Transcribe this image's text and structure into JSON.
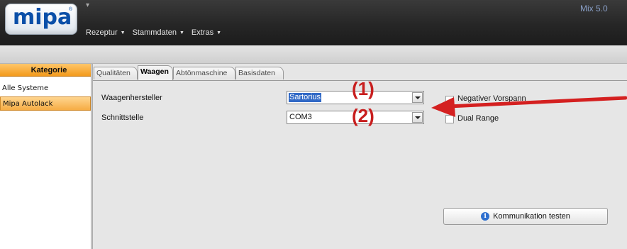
{
  "app": {
    "logo_text": "mipa",
    "logo_mark": "®",
    "title": "Mix 5.0",
    "quick_access_glyph": "▾"
  },
  "menu": [
    {
      "label": "Rezeptur"
    },
    {
      "label": "Stammdaten"
    },
    {
      "label": "Extras"
    }
  ],
  "left_panel": {
    "header": "Kategorie",
    "items": [
      {
        "label": "Alle Systeme",
        "selected": false
      },
      {
        "label": "Mipa Autolack",
        "selected": true
      }
    ]
  },
  "tabs": [
    {
      "label": "Qualitäten",
      "active": false
    },
    {
      "label": "Waagen",
      "active": true
    },
    {
      "label": "Abtönmaschine",
      "active": false
    },
    {
      "label": "Basisdaten",
      "active": false
    }
  ],
  "form": {
    "waagenhersteller_label": "Waagenhersteller",
    "waagenhersteller_value": "Sartorius",
    "schnittstelle_label": "Schnittstelle",
    "schnittstelle_value": "COM3",
    "negativer_vorspann_label": "Negativer Vorspann",
    "negativer_vorspann_checked": false,
    "dual_range_label": "Dual Range",
    "dual_range_checked": false,
    "test_button_label": "Kommunikation testen",
    "test_button_icon": "info-icon"
  },
  "annotations": {
    "marker1": "(1)",
    "marker2": "(2)",
    "arrow_color": "#d42020"
  },
  "colors": {
    "accent_orange": "#f39a1c",
    "selection_blue": "#3169c6",
    "logo_blue": "#0a4fa8"
  }
}
